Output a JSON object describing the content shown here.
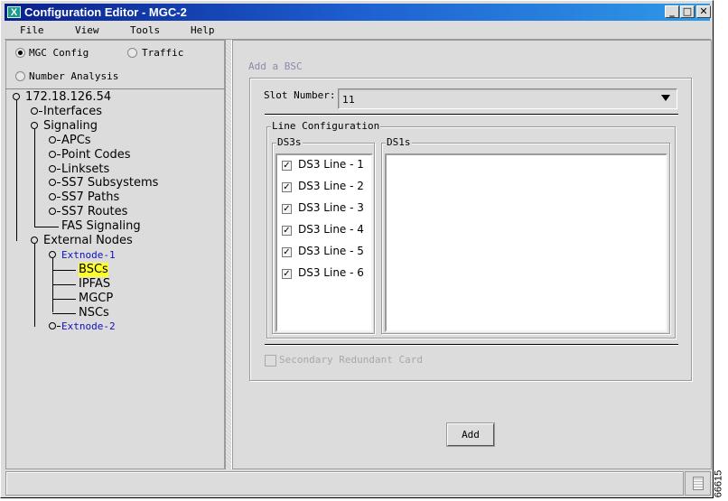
{
  "window": {
    "title": "Configuration Editor - MGC-2",
    "app_icon": "X",
    "minimize": "_",
    "maximize": "□",
    "close": "✕"
  },
  "menu": [
    "File",
    "View",
    "Tools",
    "Help"
  ],
  "modes": {
    "mgc_config": "MGC Config",
    "traffic": "Traffic",
    "number_analysis": "Number Analysis",
    "selected": "mgc_config"
  },
  "tree": [
    {
      "label": "172.18.126.54",
      "level": 0,
      "kind": "expanded"
    },
    {
      "label": "Interfaces",
      "level": 1,
      "kind": "collapsed"
    },
    {
      "label": "Signaling",
      "level": 1,
      "kind": "expanded"
    },
    {
      "label": "APCs",
      "level": 2,
      "kind": "collapsed"
    },
    {
      "label": "Point Codes",
      "level": 2,
      "kind": "collapsed"
    },
    {
      "label": "Linksets",
      "level": 2,
      "kind": "collapsed"
    },
    {
      "label": "SS7 Subsystems",
      "level": 2,
      "kind": "collapsed"
    },
    {
      "label": "SS7 Paths",
      "level": 2,
      "kind": "collapsed"
    },
    {
      "label": "SS7 Routes",
      "level": 2,
      "kind": "collapsed"
    },
    {
      "label": "FAS Signaling",
      "level": 2,
      "kind": "leaf"
    },
    {
      "label": "External Nodes",
      "level": 1,
      "kind": "expanded"
    },
    {
      "label": "Extnode-1",
      "level": 2,
      "kind": "expanded",
      "small": true
    },
    {
      "label": "BSCs",
      "level": 3,
      "kind": "leaf",
      "selected": true
    },
    {
      "label": "IPFAS",
      "level": 3,
      "kind": "leaf"
    },
    {
      "label": "MGCP",
      "level": 3,
      "kind": "leaf"
    },
    {
      "label": "NSCs",
      "level": 3,
      "kind": "leaf"
    },
    {
      "label": "Extnode-2",
      "level": 2,
      "kind": "collapsed",
      "small": true
    }
  ],
  "form": {
    "heading": "Add a BSC",
    "slot_label": "Slot Number:",
    "slot_value": "11",
    "line_config": "Line Configuration",
    "ds3s_label": "DS3s",
    "ds1s_label": "DS1s",
    "ds3_lines": [
      {
        "label": "DS3 Line - 1",
        "checked": true
      },
      {
        "label": "DS3 Line - 2",
        "checked": true
      },
      {
        "label": "DS3 Line - 3",
        "checked": true
      },
      {
        "label": "DS3 Line - 4",
        "checked": true
      },
      {
        "label": "DS3 Line - 5",
        "checked": true
      },
      {
        "label": "DS3 Line - 6",
        "checked": true
      }
    ],
    "secondary_card": "Secondary Redundant Card",
    "add_button": "Add"
  },
  "status": {
    "text": "",
    "icon": "document-icon"
  },
  "figure_number": "66615",
  "colors": {
    "selection": "#ffff30",
    "link": "#1010c0",
    "title_start": "#0a1f8c",
    "title_end": "#2f9ae8"
  }
}
